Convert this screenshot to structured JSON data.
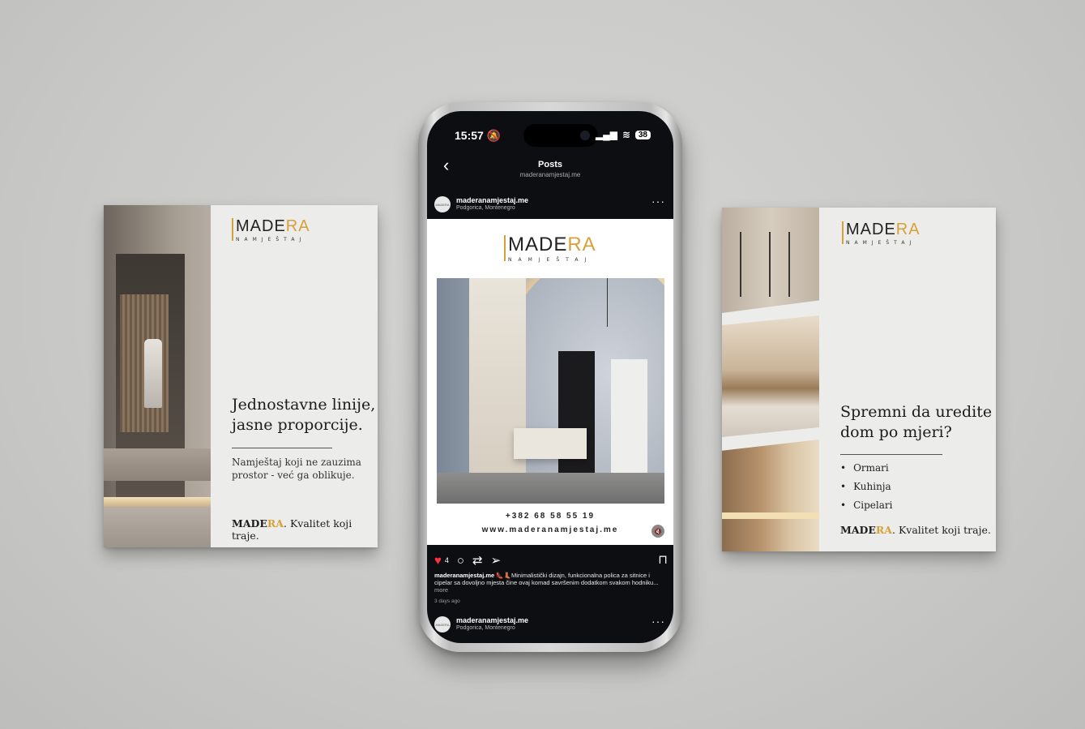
{
  "brand": {
    "wordmark_main": "MADE",
    "wordmark_accent": "RA",
    "subtitle": "NAMJEŠTAJ",
    "accent_color": "#d9a03a"
  },
  "left_card": {
    "headline_line1": "Jednostavne linije,",
    "headline_line2": "jasne proporcije.",
    "body_line1": "Namještaj koji ne zauzima",
    "body_line2": "prostor - već ga oblikuje.",
    "tagline_main": "MADE",
    "tagline_accent": "RA",
    "tagline_rest": ". Kvalitet koji traje."
  },
  "right_card": {
    "headline_line1": "Spremni da uredite",
    "headline_line2": "dom po mjeri?",
    "bullets": [
      "Ormari",
      "Kuhinja",
      "Cipelari"
    ],
    "tagline_main": "MADE",
    "tagline_accent": "RA",
    "tagline_rest": ". Kvalitet koji traje."
  },
  "phone": {
    "status": {
      "time": "15:57",
      "battery": "38"
    },
    "header": {
      "title": "Posts",
      "subtitle": "maderanamjestaj.me"
    },
    "post": {
      "username": "maderanamjestaj.me",
      "location": "Podgorica, Montenegro",
      "phone_number": "+382 68 58 55 19",
      "website": "www.maderanamjestaj.me",
      "likes": "4",
      "caption_user": "maderanamjestaj.me",
      "caption_text": "👠👢Minimalistički dizajn, funkcionalna polica za sitnice i cipelar sa dovoljno mjesta čine ovaj komad savršenim dodatkom svakom hodniku...",
      "caption_more": "more",
      "time_ago": "3 days ago"
    },
    "next_post": {
      "username": "maderanamjestaj.me",
      "location": "Podgorica, Montenegro"
    },
    "avatar_text": "MADERA"
  }
}
